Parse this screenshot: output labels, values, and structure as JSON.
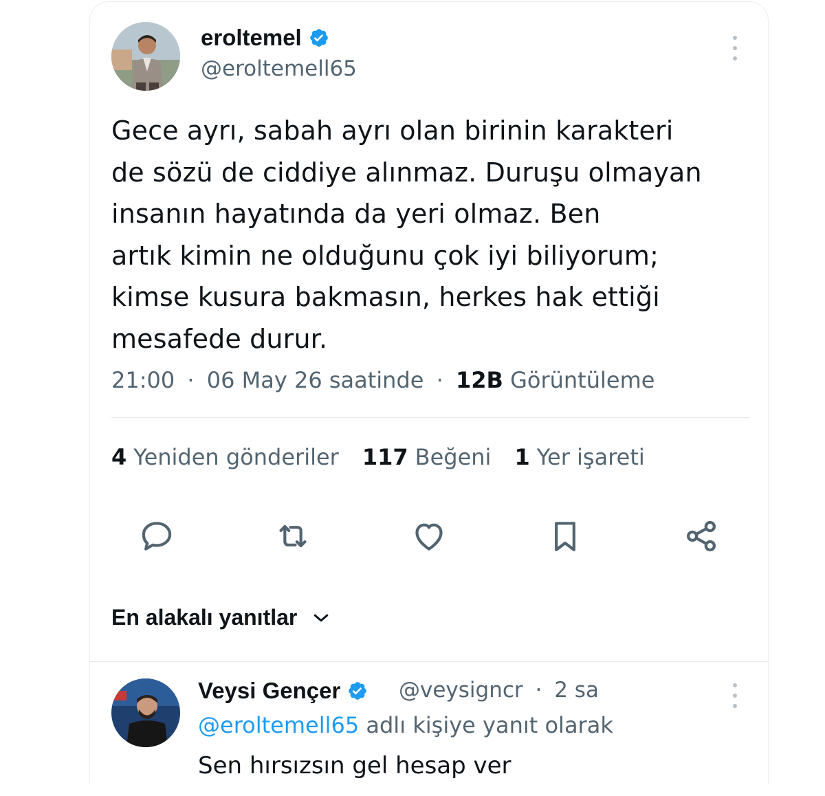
{
  "tweet": {
    "author_name": "eroltemel",
    "author_handle": "@eroltemell65",
    "lines": [
      "Gece ayrı, sabah ayrı olan birinin karakteri",
      "de sözü de ciddiye alınmaz. Duruşu olmayan",
      "insanın hayatında da yeri olmaz. Ben",
      "artık kimin ne olduğunu çok iyi biliyorum;",
      "kimse kusura bakmasın, herkes hak ettiği",
      "mesafede durur."
    ],
    "time": "21:00",
    "date": "06 May 26 saatinde",
    "views_count": "12B",
    "views_label": "Görüntüleme",
    "separator": "·"
  },
  "stats": {
    "reposts_count": "4",
    "reposts_label": "Yeniden gönderiler",
    "likes_count": "117",
    "likes_label": "Beğeni",
    "bookmarks_count": "1",
    "bookmarks_label": "Yer işareti"
  },
  "actions": [
    "reply-icon",
    "retweet-icon",
    "heart-icon",
    "bookmark-icon",
    "share-icon"
  ],
  "replies_sort": {
    "label": "En alakalı yanıtlar"
  },
  "reply": {
    "author_name": "Veysi Gençer",
    "author_handle": "@veysigncr",
    "age": "2 sa",
    "separator": "·",
    "replying_to_handle": "@eroltemell65",
    "replying_to_suffix": " adlı kişiye yanıt olarak",
    "text": "Sen hırsızsın gel hesap ver"
  },
  "colors": {
    "verified": "#1d9bf0",
    "secondary_text": "#536471",
    "primary_text": "#0f1419",
    "link": "#1d9bf0"
  }
}
